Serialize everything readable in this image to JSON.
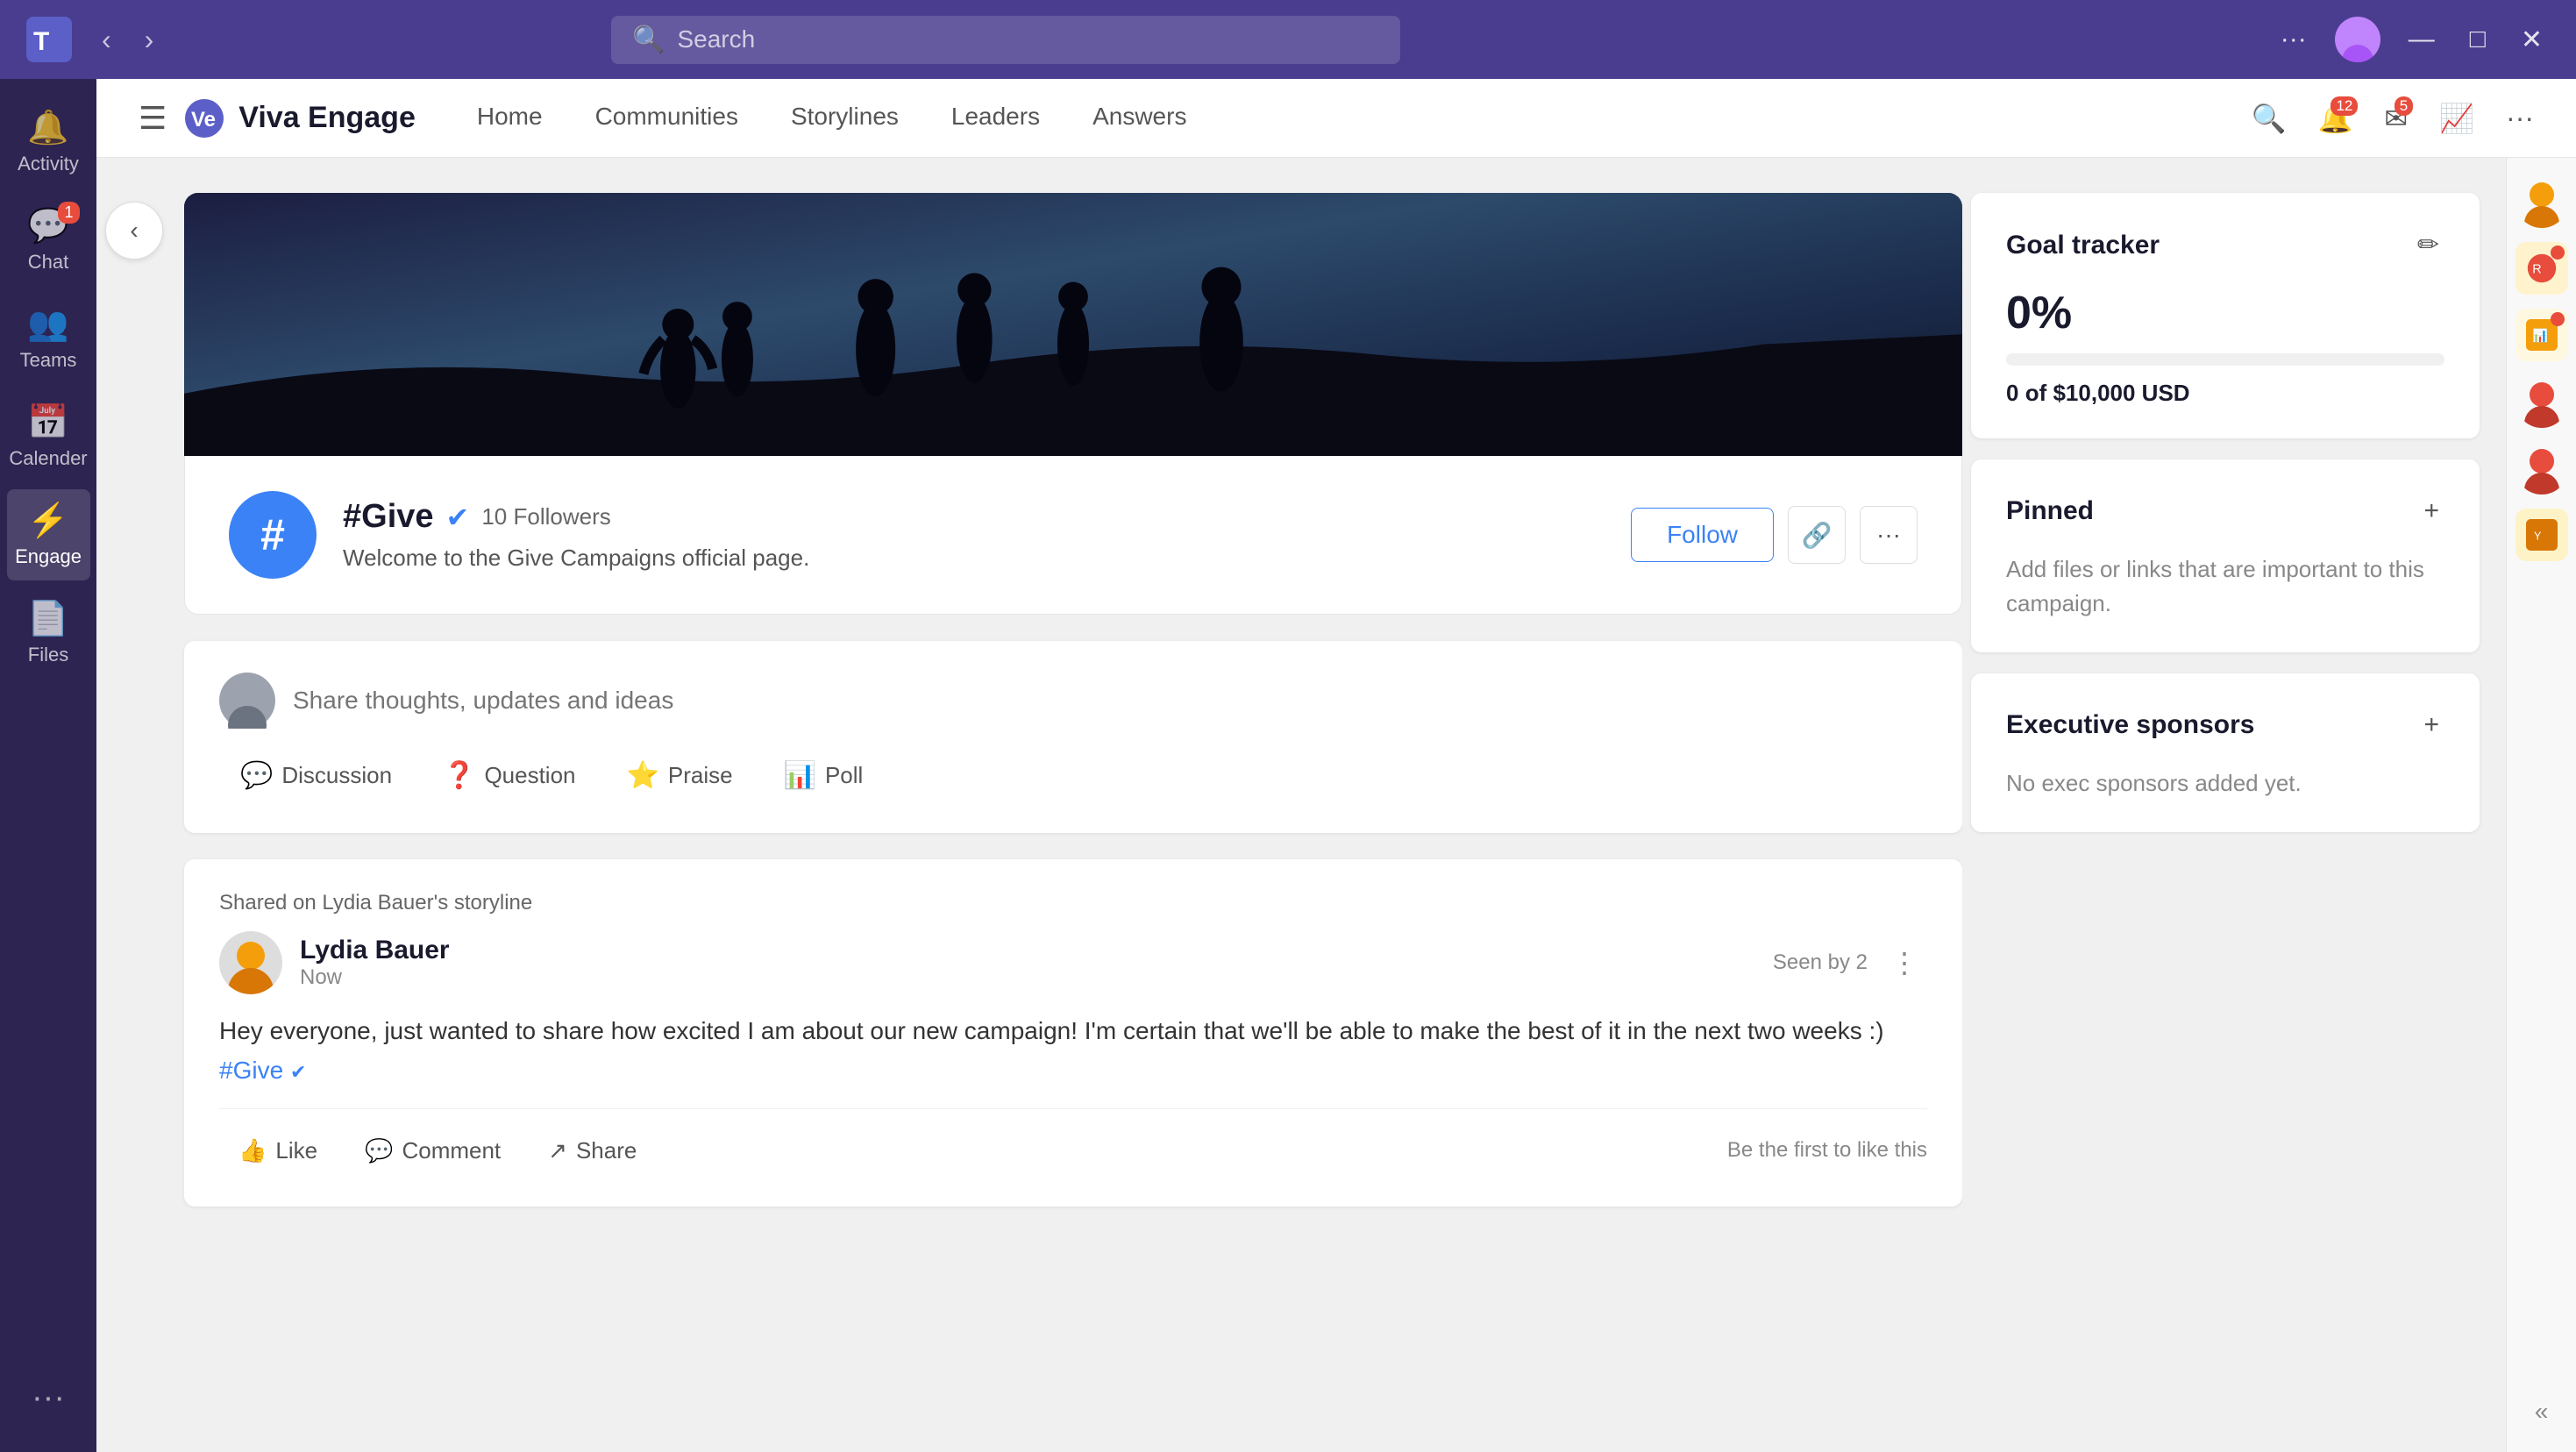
{
  "titleBar": {
    "search_placeholder": "Search",
    "more_label": "···",
    "minimize": "—",
    "maximize": "□",
    "close": "✕"
  },
  "sidebar": {
    "items": [
      {
        "id": "activity",
        "label": "Activity",
        "icon": "🔔",
        "badge": null
      },
      {
        "id": "chat",
        "label": "Chat",
        "icon": "💬",
        "badge": "1"
      },
      {
        "id": "teams",
        "label": "Teams",
        "icon": "👥",
        "badge": null
      },
      {
        "id": "calendar",
        "label": "Calender",
        "icon": "📅",
        "badge": null
      },
      {
        "id": "engage",
        "label": "Engage",
        "icon": "⚡",
        "badge": null,
        "active": true
      },
      {
        "id": "files",
        "label": "Files",
        "icon": "📄",
        "badge": null
      }
    ],
    "more": "···"
  },
  "topNav": {
    "app_name": "Viva Engage",
    "links": [
      {
        "id": "home",
        "label": "Home"
      },
      {
        "id": "communities",
        "label": "Communities"
      },
      {
        "id": "storylines",
        "label": "Storylines"
      },
      {
        "id": "leaders",
        "label": "Leaders"
      },
      {
        "id": "answers",
        "label": "Answers"
      }
    ],
    "search_icon": "🔍",
    "notifications_badge": "12",
    "messages_badge": "5",
    "trending_icon": "📈",
    "more_icon": "···"
  },
  "community": {
    "hashtag": "#",
    "name": "#Give",
    "verified": true,
    "followers_count": "10",
    "followers_label": "Followers",
    "description": "Welcome to the Give Campaigns official page.",
    "follow_label": "Follow",
    "link_icon": "🔗",
    "more_icon": "···"
  },
  "postInput": {
    "placeholder": "Share thoughts, updates and ideas",
    "types": [
      {
        "id": "discussion",
        "label": "Discussion",
        "icon": "💬",
        "color": "discussion"
      },
      {
        "id": "question",
        "label": "Question",
        "icon": "❓",
        "color": "question"
      },
      {
        "id": "praise",
        "label": "Praise",
        "icon": "⭐",
        "color": "praise"
      },
      {
        "id": "poll",
        "label": "Poll",
        "icon": "📊",
        "color": "poll"
      }
    ]
  },
  "post": {
    "shared_label": "Shared on Lydia Bauer's storyline",
    "author_name": "Lydia Bauer",
    "post_time": "Now",
    "seen_by": "Seen by 2",
    "body_text": "Hey everyone, just wanted to share how excited I am about our new campaign! I'm certain that we'll be able to make the best of it in the next two weeks :)",
    "hashtag": "#Give",
    "first_like": "Be the first to like this",
    "actions": [
      {
        "id": "like",
        "label": "Like",
        "icon": "👍"
      },
      {
        "id": "comment",
        "label": "Comment",
        "icon": "💬"
      },
      {
        "id": "share",
        "label": "Share",
        "icon": "↗"
      }
    ]
  },
  "goalTracker": {
    "title": "Goal tracker",
    "edit_icon": "✏",
    "percent": "0%",
    "progress_value": 0,
    "amount_current": "0",
    "amount_total": "$10,000 USD"
  },
  "pinned": {
    "title": "Pinned",
    "add_icon": "+",
    "description": "Add files or links that are important to this campaign."
  },
  "executiveSponsors": {
    "title": "Executive sponsors",
    "add_icon": "+",
    "description": "No exec sponsors added yet."
  }
}
